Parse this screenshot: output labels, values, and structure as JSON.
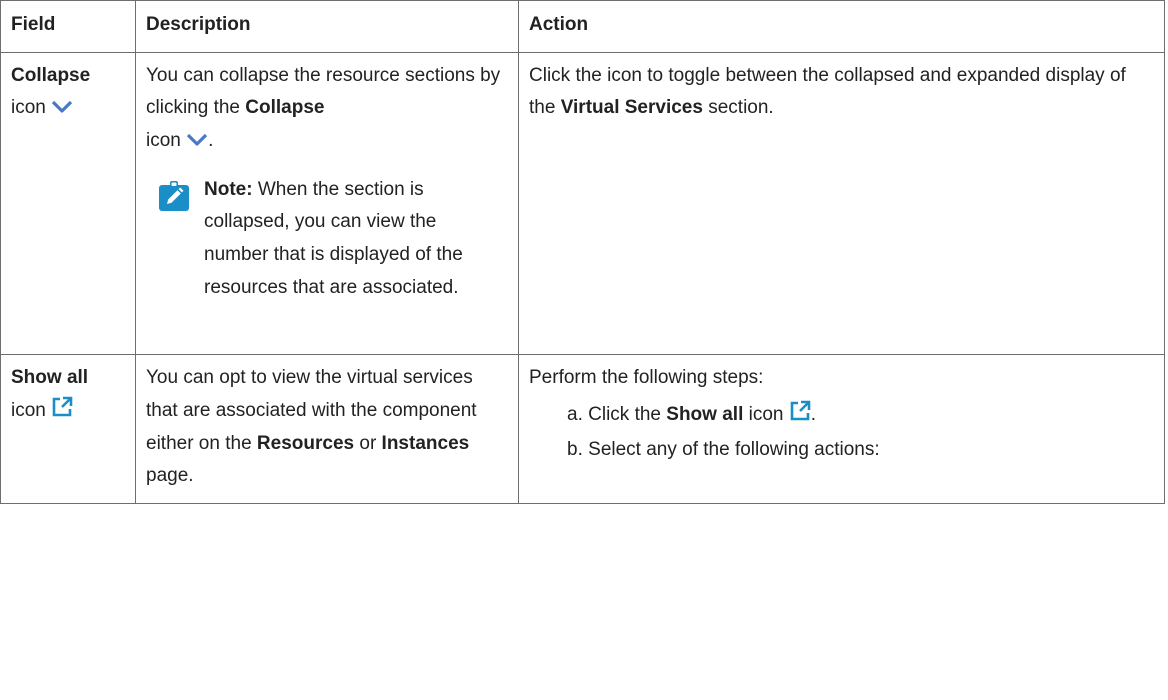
{
  "table": {
    "headers": {
      "field": "Field",
      "description": "Description",
      "action": "Action"
    },
    "rows": [
      {
        "field_bold": "Collapse",
        "field_rest": "icon",
        "field_icon": "chevron-down-icon",
        "description": {
          "before": "You can collapse the resource sections by clicking the ",
          "bold": "Collapse",
          "after": " icon",
          "end": ".",
          "icon": "chevron-down-icon",
          "note_label": "Note:",
          "note_text": " When the section is collapsed, you can view the number that is displayed of the re­sources that are associ­ated.",
          "note_icon": "pencil-note-icon"
        },
        "action": {
          "before": "Click the icon to toggle between the collapsed and expand­ed display of the ",
          "bold": "Virtual Services",
          "after": " section."
        }
      },
      {
        "field_bold": "Show all",
        "field_rest": "icon",
        "field_icon": "external-link-icon",
        "description": {
          "before": "You can opt to view the virtual services that are associated with the component either on the ",
          "bold1": "Re­sources",
          "middle": " or ",
          "bold2": "Instances",
          "after": " page."
        },
        "action": {
          "intro": "Perform the following steps:",
          "steps": [
            {
              "marker": "a.",
              "before": "Click the ",
              "bold": "Show all",
              "after": " icon",
              "end": ".",
              "icon": "external-link-icon"
            },
            {
              "marker": "b.",
              "text": "Select any of the following actions:"
            }
          ]
        }
      }
    ]
  },
  "colors": {
    "icon_blue": "#1a8fc7",
    "chevron_blue": "#4a78c8",
    "border": "#6e6e6e"
  }
}
